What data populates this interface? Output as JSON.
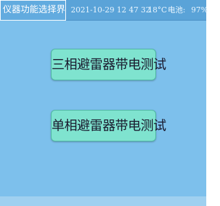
{
  "header": {
    "title": "仪器功能选择界面",
    "datetime": "2021-10-29  12 47 32",
    "temperature": "18°C",
    "battery_label": "电池:",
    "battery_value": "97%"
  },
  "buttons": {
    "three_phase": "三相避雷器带电测试",
    "single_phase": "单相避雷器带电测试"
  },
  "colors": {
    "background": "#7dc0ec",
    "header": "#5aa3d8",
    "button": "#7fe3cf"
  }
}
